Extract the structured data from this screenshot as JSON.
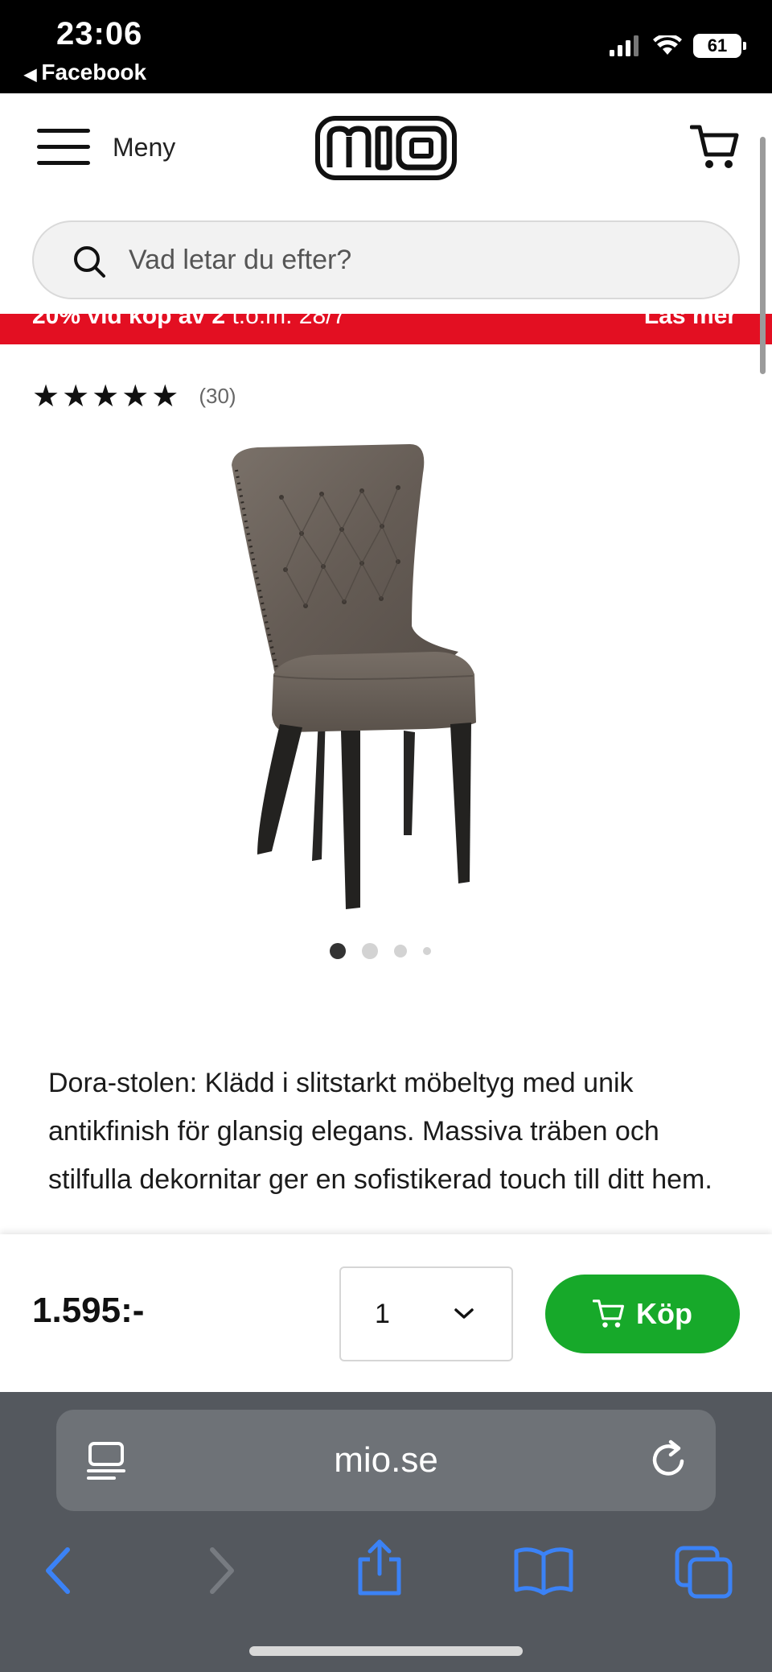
{
  "status_bar": {
    "time": "23:06",
    "back_app": "Facebook",
    "battery": "61"
  },
  "header": {
    "menu_label": "Meny",
    "logo_text": "mio"
  },
  "search": {
    "placeholder": "Vad letar du efter?"
  },
  "promo": {
    "text": "20% vid köp av 2",
    "date": " t.o.m. 28/7",
    "link": "Läs mer"
  },
  "product": {
    "rating": {
      "stars": 5,
      "stars_text": "★★★★★",
      "count": "(30)"
    },
    "image_count": 4,
    "active_image": 1,
    "description": "Dora-stolen: Klädd i slitstarkt möbeltyg med unik antikfinish för glansig elegans. Massiva träben och stilfulla dekornitar ger en sofistikerad touch till ditt hem.",
    "price": "1.595:-",
    "quantity": "1",
    "buy_label": "Köp"
  },
  "browser": {
    "url": "mio.se"
  },
  "colors": {
    "promo": "#e30f22",
    "buy_button": "#17a92a",
    "browser_chrome": "#54585e",
    "toolbar_icons": "#3b82f6"
  }
}
